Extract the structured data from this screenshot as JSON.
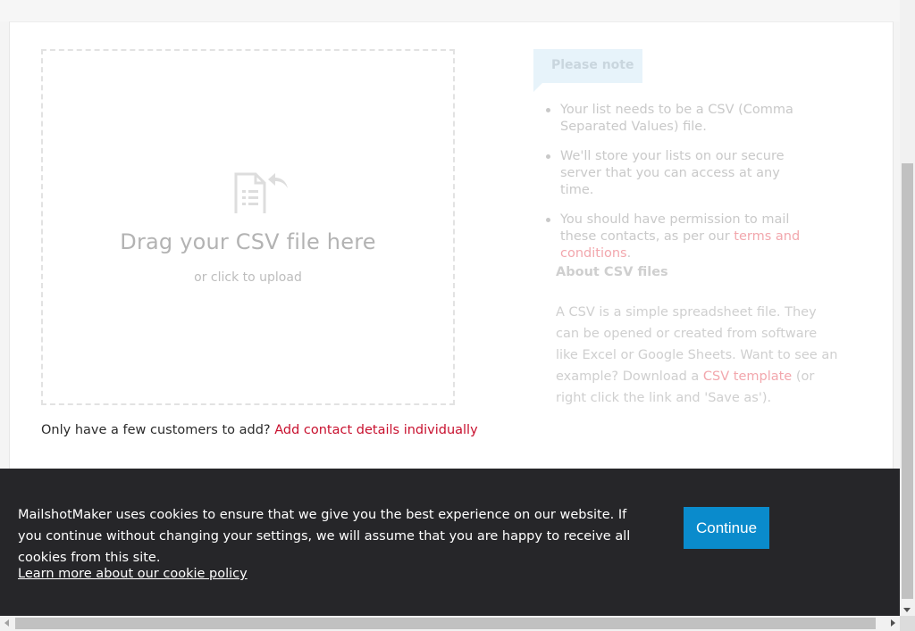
{
  "upload": {
    "icon": "csv-document-icon",
    "title": "Drag your CSV file here",
    "subtitle": "or click to upload"
  },
  "few_customers": {
    "prefix": "Only have a few customers to add?",
    "link": "Add contact details individually"
  },
  "note": {
    "tag": "Please note",
    "items": [
      {
        "text": "Your list needs to be a CSV (Comma Separated Values) file."
      },
      {
        "text": "We'll store your lists on our secure server that you can access at any time."
      },
      {
        "text_before": "You should have permission to mail these contacts, as per our",
        "link": "terms and conditions",
        "text_after": "."
      }
    ]
  },
  "about": {
    "title": "About CSV files",
    "body_before": "A CSV is a simple spreadsheet file. They can be opened or created from software like Excel or Google Sheets. Want to see an example? Download a",
    "link": "CSV template",
    "body_after": "(or right click the link and 'Save as')."
  },
  "cookie": {
    "message": "MailshotMaker uses cookies to ensure that we give you the best experience on our website. If you continue without changing your settings, we will assume that you are happy to receive all cookies from this site.",
    "policy_link": "Learn more about our cookie policy",
    "continue_label": "Continue"
  },
  "colors": {
    "accent_red": "#c8102e",
    "button_blue": "#0a8bcc",
    "cookie_bg": "#262629",
    "note_bg": "#e7f3fa"
  }
}
